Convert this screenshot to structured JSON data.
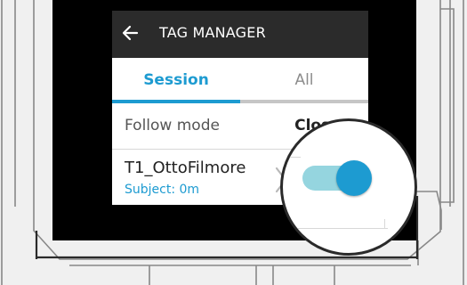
{
  "screen": {
    "header": {
      "title": "TAG MANAGER",
      "back_icon": "arrow-left-icon"
    },
    "tabs": [
      {
        "label": "Session",
        "selected": true
      },
      {
        "label": "All",
        "selected": false
      }
    ],
    "follow_mode": {
      "label": "Follow mode",
      "value": "Closest"
    },
    "subject": {
      "name": "T1_OttoFilmore",
      "meta": "Subject: 0m",
      "chevron_icon": "chevron-right-icon"
    },
    "toggle": {
      "state": "on"
    }
  },
  "colors": {
    "accent": "#1d9bd1",
    "header_bg": "#2b2b2b",
    "toggle_track": "#95d5df",
    "tab_inactive": "#8c8c8c",
    "device_bezel": "#000000"
  }
}
